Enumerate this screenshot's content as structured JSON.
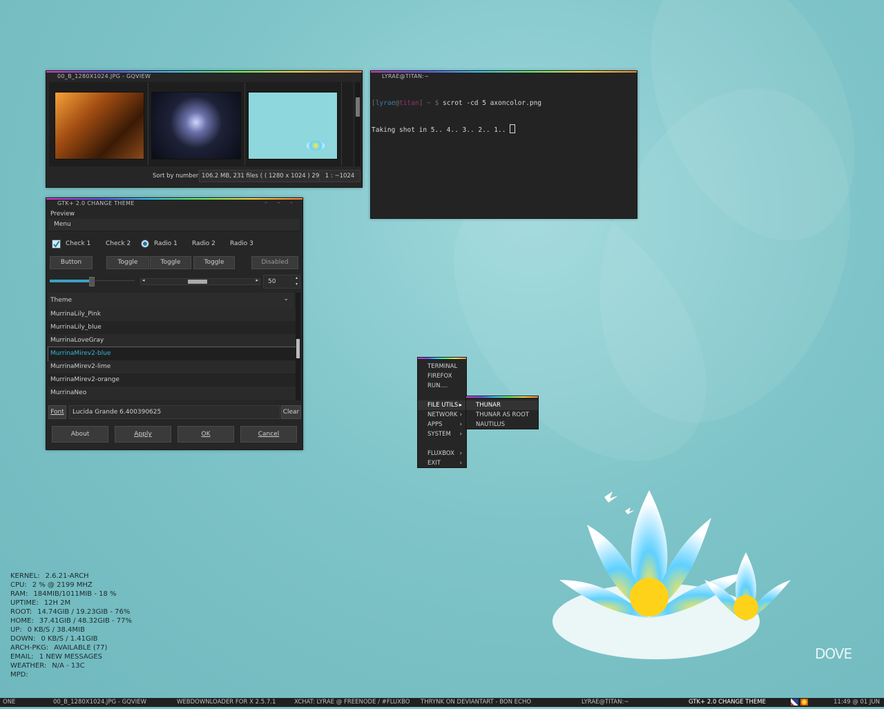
{
  "gqview": {
    "title": "00_B_1280X1024.JPG - GQVIEW",
    "status": {
      "sort": "Sort by number",
      "info": "106.2 MB, 231 files (2",
      "dims": "( 1280 x 1024 ) 29(",
      "zoom": "1 : ~1024"
    }
  },
  "terminal": {
    "title": "LYRAE@TITAN:~",
    "user": "lyrae",
    "at": "@",
    "host": "titan",
    "prompt_rest": "] ~ $",
    "bracket": "[",
    "command": "scrot -cd 5 axoncolor.png",
    "output": "Taking shot in 5.. 4.. 3.. 2.. 1.."
  },
  "gtk": {
    "title": "GTK+ 2.0 CHANGE THEME",
    "preview_label": "Preview",
    "menu_label": "Menu",
    "checks": [
      "Check 1",
      "Check 2"
    ],
    "radios": [
      "Radio 1",
      "Radio 2",
      "Radio 3"
    ],
    "buttons": {
      "button": "Button",
      "toggle1": "Toggle",
      "toggle2": "Toggle",
      "toggle3": "Toggle",
      "disabled": "Disabled"
    },
    "spin_value": "50",
    "list_header": "Theme",
    "themes": [
      "MurrinaLily_Pink",
      "MurrinaLily_blue",
      "MurrinaLoveGray",
      "MurrinaMirev2-blue",
      "MurrinaMirev2-lime",
      "MurrinaMirev2-orange",
      "MurrinaNeo"
    ],
    "selected_index": 3,
    "font_label": "Font",
    "font_value": "Lucida Grande 6.400390625",
    "clear": "Clear",
    "actions": {
      "about": "About",
      "apply": "Apply",
      "ok": "OK",
      "cancel": "Cancel"
    }
  },
  "menu": {
    "items_top": [
      "TERMINAL",
      "FIREFOX",
      "RUN...."
    ],
    "items_sub": [
      "FILE UTILS",
      "NETWORK",
      "APPS",
      "SYSTEM"
    ],
    "items_bottom": [
      "FLUXBOX",
      "EXIT"
    ],
    "submenu": [
      "THUNAR",
      "THUNAR AS ROOT",
      "NAUTILUS"
    ]
  },
  "conky": [
    {
      "k": "KERNEL:",
      "v": "2.6.21-ARCH"
    },
    {
      "k": "CPU:",
      "v": "2  % @ 2199 MHZ"
    },
    {
      "k": "RAM:",
      "v": "184MIB/1011MIB - 18 %"
    },
    {
      "k": "UPTIME:",
      "v": "12H 2M"
    },
    {
      "k": "ROOT:",
      "v": "14.74GIB / 19.23GIB - 76%"
    },
    {
      "k": "HOME:",
      "v": "37.41GIB / 48.32GIB - 77%"
    },
    {
      "k": "UP:",
      "v": "0   KB/S / 38.4MIB"
    },
    {
      "k": "DOWN:",
      "v": "0    KB/S / 1.41GIB"
    },
    {
      "k": "ARCH-PKG:",
      "v": "AVAILABLE (77)"
    },
    {
      "k": "EMAIL:",
      "v": "1 NEW MESSAGES"
    },
    {
      "k": "WEATHER:",
      "v": "N/A - 13C"
    },
    {
      "k": "MPD:",
      "v": ""
    }
  ],
  "logo": "DOVE",
  "taskbar": {
    "workspace": "ONE",
    "tasks": [
      "00_B_1280X1024.JPG - GQVIEW",
      "WEBDOWNLOADER FOR X 2.5.7.1",
      "XCHAT: LYRAE @ FREENODE / #FLUXBO",
      "THRYNK ON DEVIANTART - BON ECHO",
      "LYRAE@TITAN:~",
      "GTK+ 2.0 CHANGE THEME"
    ],
    "clock": "11:49 @ 01 JUN"
  },
  "colors": {
    "accent": "#33b5d6",
    "panel": "#262626",
    "desktop": "#7ec4c8"
  }
}
